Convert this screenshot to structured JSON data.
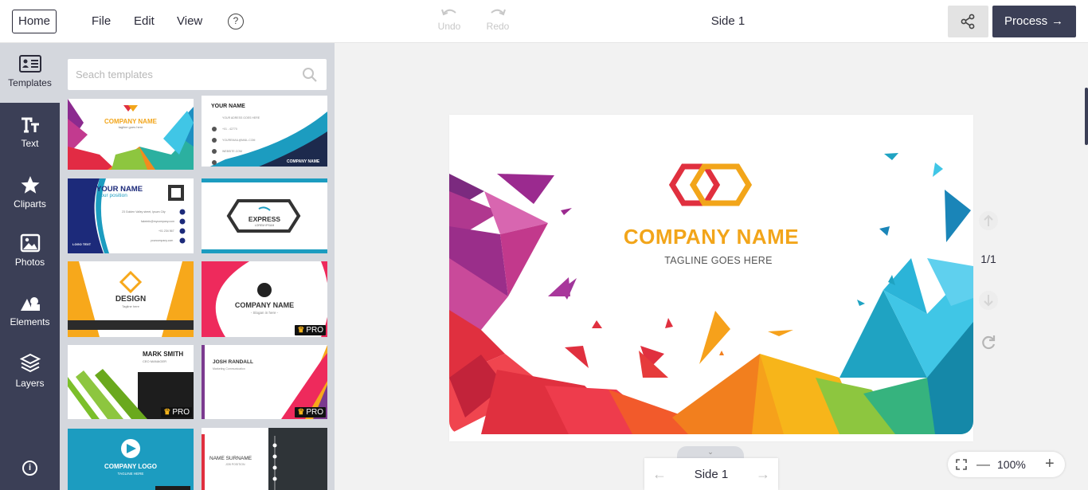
{
  "menu": {
    "home": "Home",
    "file": "File",
    "edit": "Edit",
    "view": "View",
    "help": "?",
    "undo": "Undo",
    "redo": "Redo",
    "doc_title": "Side 1",
    "process": "Process"
  },
  "rail": {
    "templates": "Templates",
    "text": "Text",
    "cliparts": "Cliparts",
    "photos": "Photos",
    "elements": "Elements",
    "layers": "Layers",
    "info": "i"
  },
  "search": {
    "placeholder": "Seach templates"
  },
  "templates": {
    "t1": {
      "name": "COMPANY NAME",
      "sub": "tagline goes here"
    },
    "t2": {
      "name": "YOUR NAME",
      "lines": [
        "YOUR ADRESS GOES HERE",
        "+01 - 42770",
        "YOUREMAIL@MAIL.COM",
        "WEBSITE.COM"
      ],
      "company": "COMPANY NAME"
    },
    "t3": {
      "name": "YOUR NAME",
      "pos": "your position",
      "logo": "LOGO TEXT",
      "lines": [
        "23 Golden Valley street, Ipsum City",
        "fakeinfo@mycompany.com",
        "+01 234 567",
        "yourcompany.com"
      ]
    },
    "t4": {
      "name": "EXPRESS",
      "sub": "LOREM IPSUM"
    },
    "t5": {
      "name": "DESIGN",
      "sub": "Tagline here"
    },
    "t6": {
      "name": "COMPANY NAME",
      "sub": "- Slogan in here -",
      "pro": "PRO"
    },
    "t7": {
      "name": "MARK SMITH",
      "pos": "CEO MANAGER",
      "pro": "PRO"
    },
    "t8": {
      "name": "JOSH RANDALL",
      "pos": "Marketing Communication",
      "pro": "PRO"
    },
    "t9": {
      "name": "COMPANY LOGO",
      "sub": "TAGLINE HERE"
    },
    "t10": {
      "name": "NAME SURNAME",
      "pos": "JOB POSITION"
    }
  },
  "card": {
    "company": "COMPANY NAME",
    "tagline": "TAGLINE GOES HERE",
    "colors": {
      "orange": "#f2a51a",
      "red": "#e0303f",
      "teal": "#1fa3c2"
    }
  },
  "page": {
    "count": "1/1",
    "side_label": "Side 1"
  },
  "zoom": {
    "level": "100%"
  },
  "colors": {
    "dark": "#3b3f56",
    "panel": "#d4d7dd"
  }
}
